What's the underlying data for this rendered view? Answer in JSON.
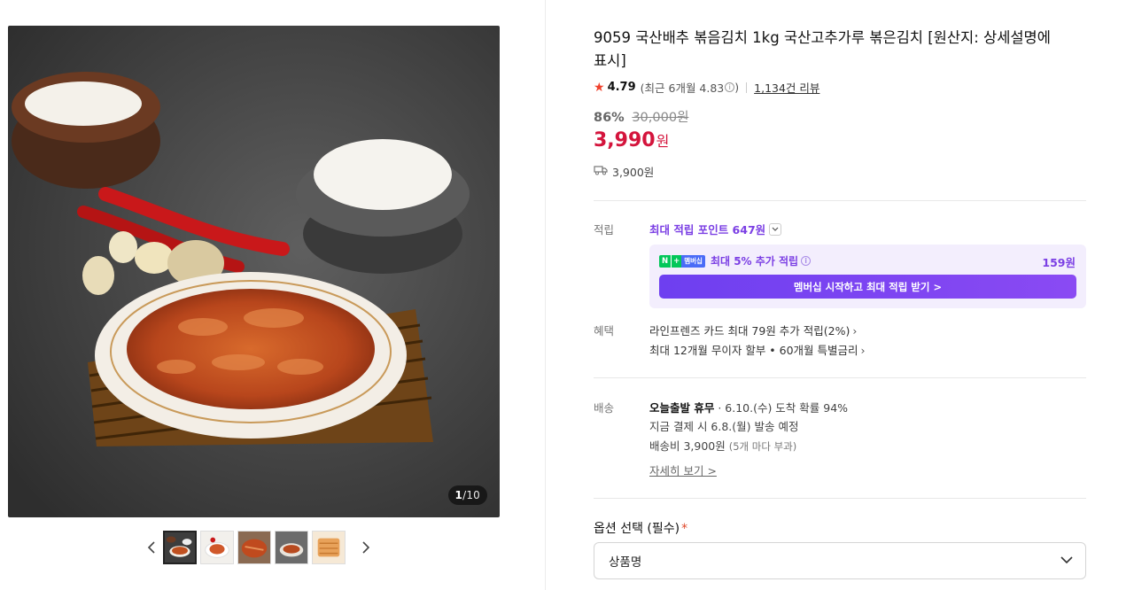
{
  "gallery": {
    "counter_current": "1",
    "counter_total": "/10",
    "thumbnails": [
      "thumb-1",
      "thumb-2",
      "thumb-3",
      "thumb-4",
      "thumb-5"
    ],
    "icons": {
      "prev": "chevron-left-icon",
      "next": "chevron-right-icon"
    }
  },
  "product": {
    "title": "9059 국산배추 볶음김치 1kg 국산고추가루 볶은김치 [원산지: 상세설명에 표시]",
    "rating": "4.79",
    "recent_rating": "(최근 6개월 4.83",
    "recent_rating_close": ")",
    "review_count": "1,134건 리뷰",
    "discount_rate": "86%",
    "original_price": "30,000원",
    "price": "3,990",
    "price_unit": "원",
    "shipping_fee": "3,900원"
  },
  "reward": {
    "label": "적립",
    "max_points": "최대 적립 포인트 647원",
    "membership_badge": "멤버십",
    "membership_text": "최대 5% 추가 적립",
    "membership_points": "159원",
    "membership_button": "멤버십 시작하고 최대 적립 받기 >"
  },
  "benefit": {
    "label": "혜택",
    "lines": [
      "라인프렌즈 카드 최대 79원 추가 적립(2%)",
      "최대 12개월 무이자 할부 • 60개월 특별금리"
    ]
  },
  "delivery": {
    "label": "배송",
    "line1_bold": "오늘출발 휴무",
    "line1_rest": " · 6.10.(수) 도착 확률 94%",
    "line2": "지금 결제 시 6.8.(월) 발송 예정",
    "line3": "배송비 3,900원 ",
    "line3_gray": "(5개 마다 부과)",
    "detail_link": "자세히 보기 >"
  },
  "option": {
    "label": "옵션 선택 (필수)",
    "required_mark": "*",
    "select_value": "상품명"
  },
  "colors": {
    "price": "#d4143c",
    "purple": "#7b3fe4",
    "star": "#f0412c"
  }
}
